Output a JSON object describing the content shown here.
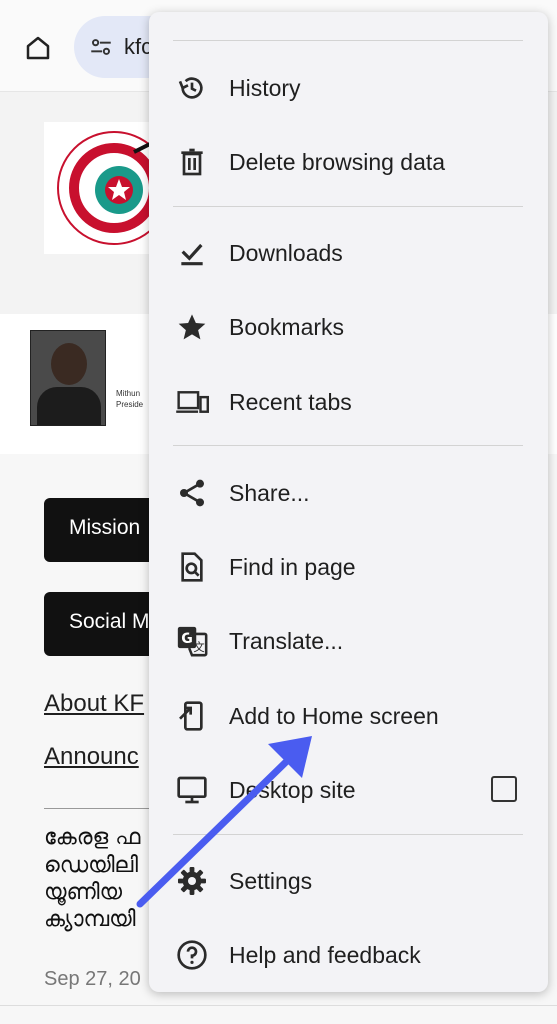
{
  "browser": {
    "url_text": "kfc"
  },
  "page": {
    "caption_line1": "Mithun",
    "caption_line2": "Preside",
    "buttons": [
      "Mission",
      "Social M"
    ],
    "links": [
      "About KF",
      "Announc"
    ],
    "malayalam_lines": [
      "കേരള ഫ",
      "ഡെയിലി",
      "യൂണിയ",
      "ക്യാമ്പയി"
    ],
    "date": "Sep 27, 20"
  },
  "menu": {
    "items": [
      {
        "label": "History",
        "icon": "history-icon"
      },
      {
        "label": "Delete browsing data",
        "icon": "trash-icon"
      },
      {
        "label": "Downloads",
        "icon": "download-check-icon"
      },
      {
        "label": "Bookmarks",
        "icon": "star-icon"
      },
      {
        "label": "Recent tabs",
        "icon": "devices-icon"
      },
      {
        "label": "Share...",
        "icon": "share-icon"
      },
      {
        "label": "Find in page",
        "icon": "find-in-page-icon"
      },
      {
        "label": "Translate...",
        "icon": "translate-icon"
      },
      {
        "label": "Add to Home screen",
        "icon": "add-to-home-icon"
      },
      {
        "label": "Desktop site",
        "icon": "desktop-icon",
        "checked": false
      },
      {
        "label": "Settings",
        "icon": "gear-icon"
      },
      {
        "label": "Help and feedback",
        "icon": "help-icon"
      }
    ]
  },
  "annotation": {
    "arrow_color": "#4a5cf0"
  }
}
